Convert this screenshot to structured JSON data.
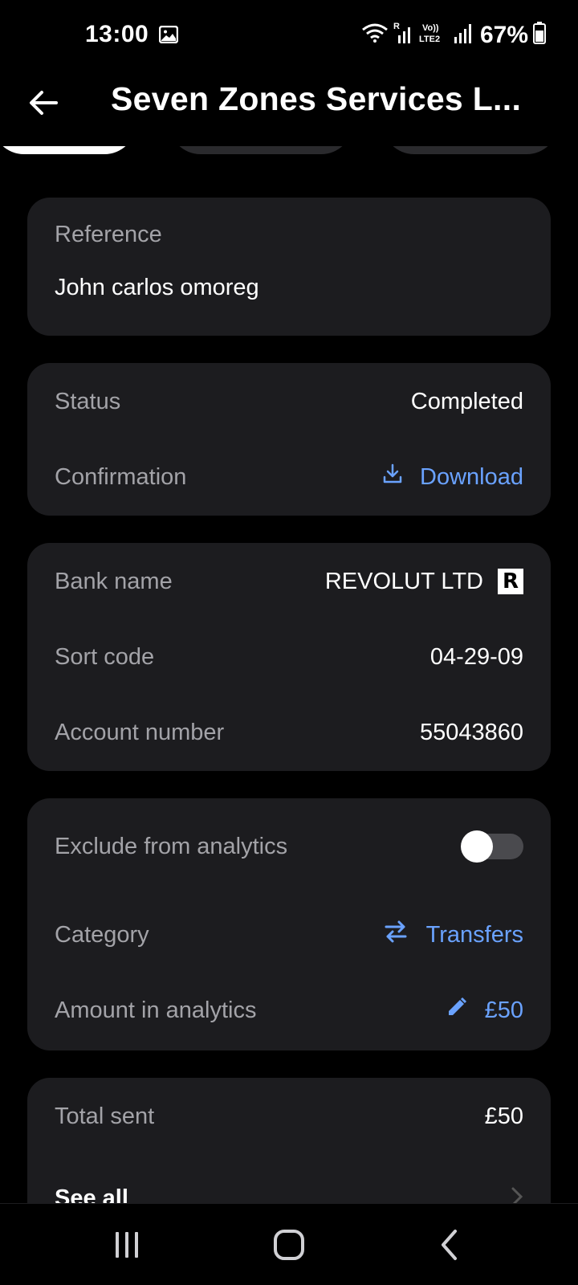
{
  "status_bar": {
    "time": "13:00",
    "battery": "67%",
    "icons": [
      "gallery-icon",
      "wifi-icon",
      "signal-icon",
      "volte-icon",
      "signal-icon",
      "battery-icon"
    ],
    "roaming_label": "R",
    "volte_label": "Vo)) LTE2"
  },
  "header": {
    "title": "Seven Zones Services L..."
  },
  "reference": {
    "label": "Reference",
    "value": "John carlos omoreg"
  },
  "status_card": {
    "status_label": "Status",
    "status_value": "Completed",
    "confirmation_label": "Confirmation",
    "download_label": "Download"
  },
  "bank_card": {
    "bank_label": "Bank name",
    "bank_value": "REVOLUT LTD",
    "bank_logo_letter": "R",
    "sort_label": "Sort code",
    "sort_value": "04-29-09",
    "account_label": "Account number",
    "account_value": "55043860"
  },
  "analytics_card": {
    "exclude_label": "Exclude from analytics",
    "exclude_toggle_on": false,
    "category_label": "Category",
    "category_value": "Transfers",
    "amount_label": "Amount in analytics",
    "amount_value": "£50"
  },
  "total_card": {
    "total_label": "Total sent",
    "total_value": "£50",
    "see_all_label": "See all"
  },
  "colors": {
    "background": "#000000",
    "card": "#1c1c1f",
    "accent": "#6aa2ff",
    "label": "#a3a3a8"
  }
}
